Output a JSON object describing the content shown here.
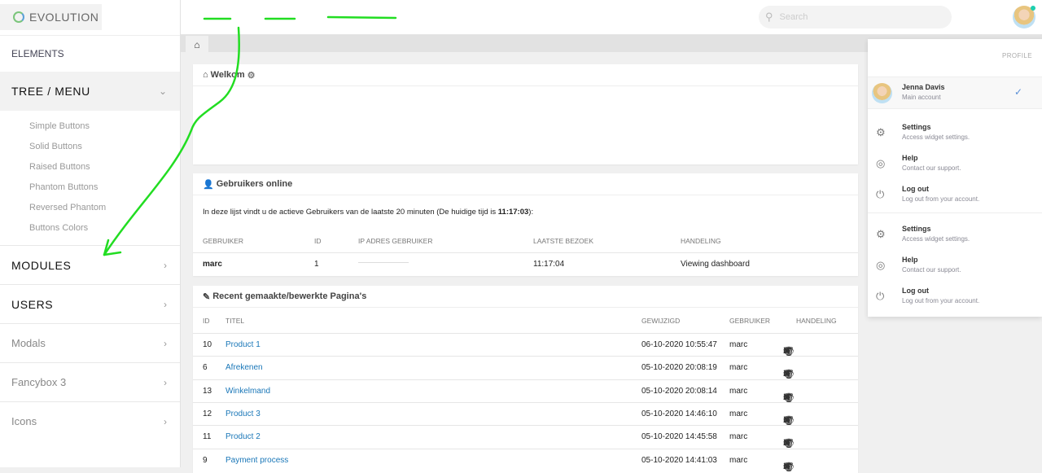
{
  "brand": "EVOLUTION",
  "sidebar": {
    "elements": "ELEMENTS",
    "tree": "TREE / MENU",
    "sub": [
      "Simple Buttons",
      "Solid Buttons",
      "Raised Buttons",
      "Phantom Buttons",
      "Reversed Phantom",
      "Buttons Colors"
    ],
    "modules": "MODULES",
    "users": "USERS",
    "modals": "Modals",
    "fancybox": "Fancybox 3",
    "icons": "Icons"
  },
  "header": {
    "search_placeholder": "Search"
  },
  "welcome": {
    "title": "Welkom"
  },
  "online": {
    "title": "Gebruikers online",
    "intro": "In deze lijst vindt u de actieve Gebruikers van de laatste 20 minuten (De huidige tijd is ",
    "time": "11:17:03",
    "intro_end": "):",
    "columns": [
      "GEBRUIKER",
      "ID",
      "IP ADRES GEBRUIKER",
      "LAATSTE BEZOEK",
      "HANDELING"
    ],
    "rows": [
      {
        "user": "marc",
        "id": "1",
        "last": "11:17:04",
        "action": "Viewing dashboard"
      }
    ]
  },
  "recent": {
    "title": "Recent gemaakte/bewerkte Pagina's",
    "columns": [
      "ID",
      "TITEL",
      "GEWIJZIGD",
      "GEBRUIKER",
      "HANDELING"
    ],
    "rows": [
      {
        "id": "10",
        "title": "Product 1",
        "date": "06-10-2020 10:55:47",
        "user": "marc"
      },
      {
        "id": "6",
        "title": "Afrekenen",
        "date": "05-10-2020 20:08:19",
        "user": "marc"
      },
      {
        "id": "13",
        "title": "Winkelmand",
        "date": "05-10-2020 20:08:14",
        "user": "marc"
      },
      {
        "id": "12",
        "title": "Product 3",
        "date": "05-10-2020 14:46:10",
        "user": "marc"
      },
      {
        "id": "11",
        "title": "Product 2",
        "date": "05-10-2020 14:45:58",
        "user": "marc"
      },
      {
        "id": "9",
        "title": "Payment process",
        "date": "05-10-2020 14:41:03",
        "user": "marc"
      }
    ]
  },
  "profile": {
    "heading": "PROFILE",
    "name": "Jenna Davis",
    "account": "Main account",
    "items": [
      {
        "title": "Settings",
        "desc": "Access widget settings.",
        "icon": "gear-icon"
      },
      {
        "title": "Help",
        "desc": "Contact our support.",
        "icon": "lifebuoy-icon"
      },
      {
        "title": "Log out",
        "desc": "Log out from your account.",
        "icon": "power-icon"
      },
      {
        "title": "Settings",
        "desc": "Access widget settings.",
        "icon": "gear-icon"
      },
      {
        "title": "Help",
        "desc": "Contact our support.",
        "icon": "lifebuoy-icon"
      },
      {
        "title": "Log out",
        "desc": "Log out from your account.",
        "icon": "power-icon"
      }
    ]
  },
  "colors": {
    "link": "#1a77b8",
    "annotation": "#22dd22",
    "online": "#1ccfb0"
  }
}
